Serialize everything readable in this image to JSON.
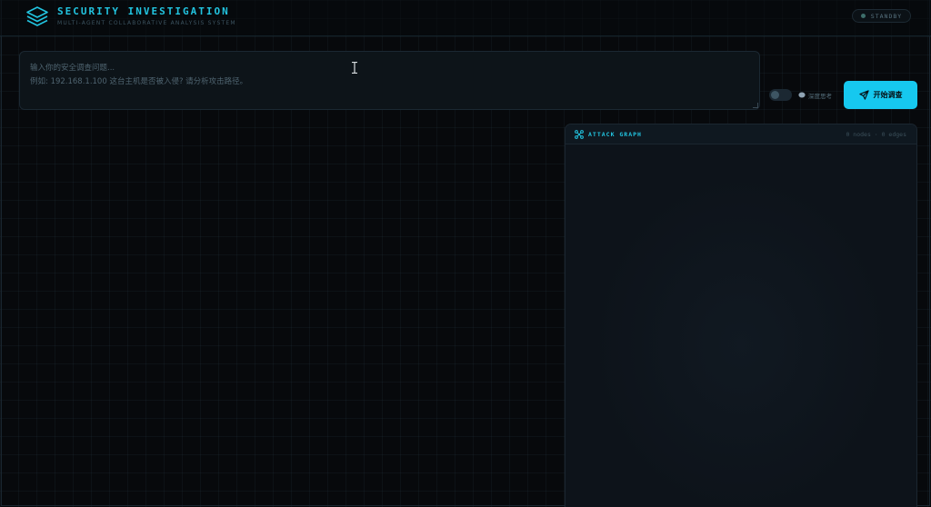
{
  "header": {
    "title": "SECURITY INVESTIGATION",
    "subtitle": "MULTI-AGENT COLLABORATIVE ANALYSIS SYSTEM",
    "status": "STANDBY",
    "logo_icon": "layers-icon"
  },
  "query": {
    "placeholder_line1": "输入你的安全调查问题...",
    "placeholder_line2": "例如: 192.168.1.100 这台主机是否被入侵? 请分析攻击路径。"
  },
  "options": {
    "deep_thinking_label": "深度思考",
    "deep_thinking_enabled": false,
    "deep_thinking_icon": "brain-icon"
  },
  "actions": {
    "start_label": "开始调查",
    "start_icon": "send-icon"
  },
  "graph": {
    "title": "ATTACK GRAPH",
    "stats": "0 nodes · 0 edges",
    "icon": "graph-nodes-icon"
  },
  "colors": {
    "accent": "#16c8ef",
    "background": "#07090c",
    "panel": "#0d131a"
  }
}
